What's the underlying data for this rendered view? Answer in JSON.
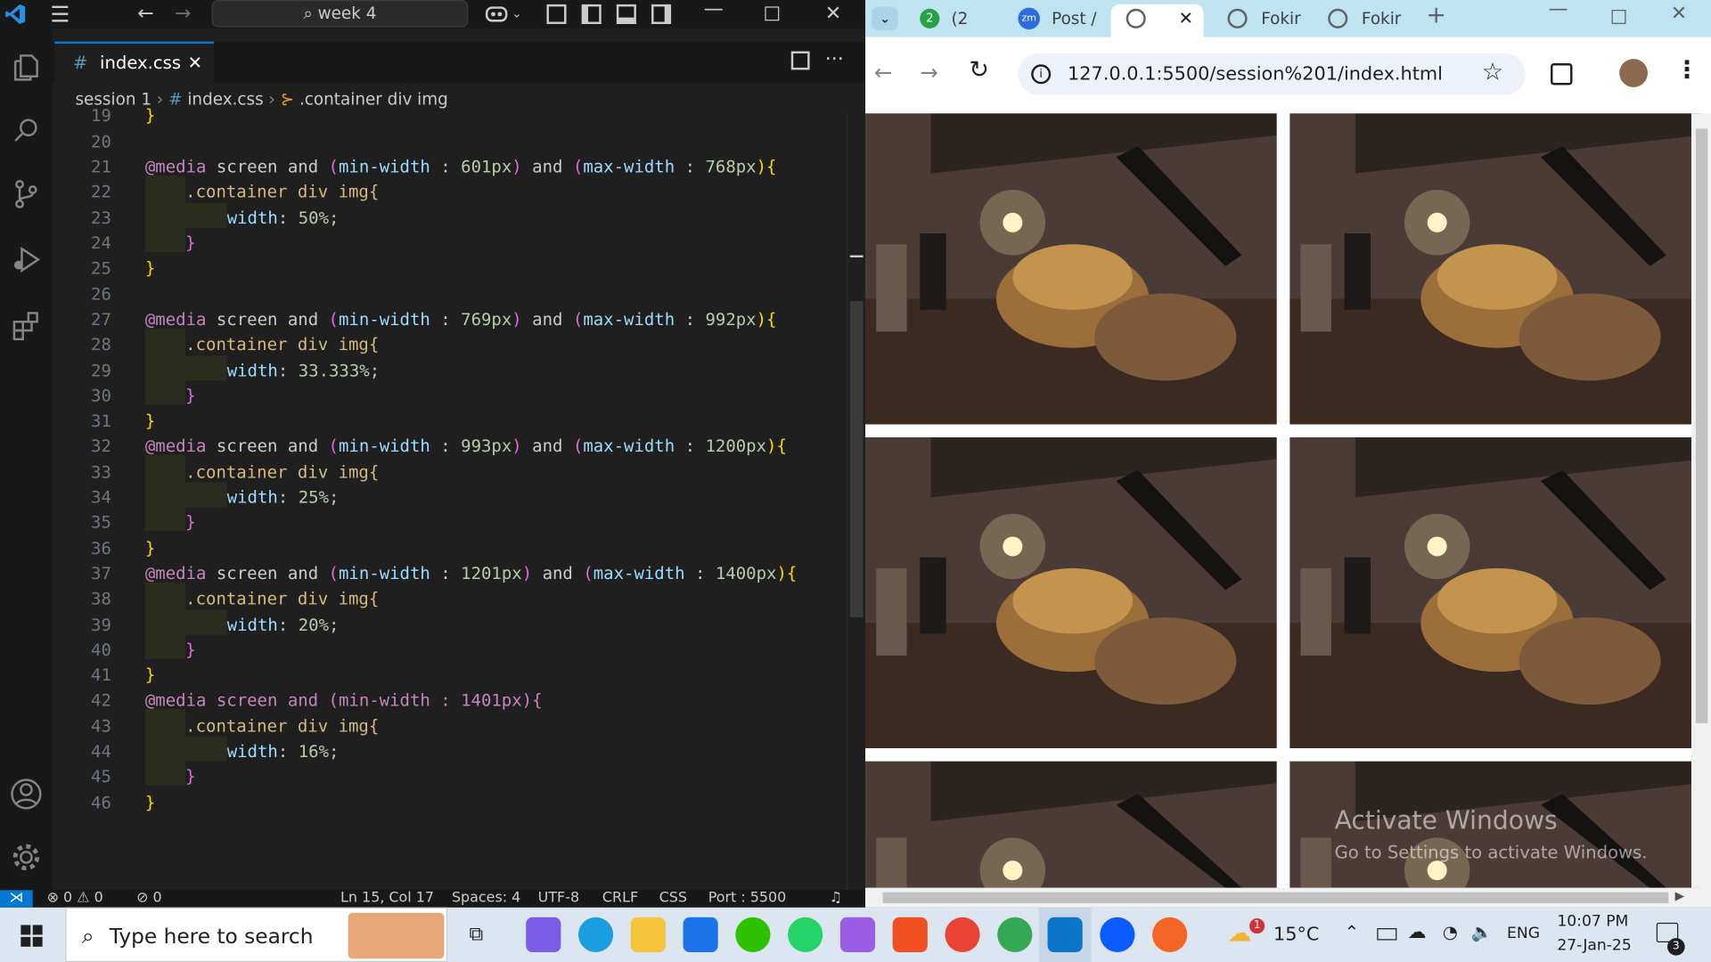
{
  "vscode": {
    "search_text": "week 4",
    "tab_title": "index.css",
    "breadcrumb": [
      "session 1",
      "index.css",
      ".container div img"
    ],
    "status_left": [
      "⊗ 0 ⚠ 0",
      "⊘ 0"
    ],
    "status_right": [
      "Ln 15, Col 17",
      "Spaces: 4",
      "UTF-8",
      "CRLF",
      "CSS",
      "Port : 5500"
    ],
    "line_numbers": [
      "19",
      "20",
      "21",
      "22",
      "23",
      "24",
      "25",
      "26",
      "27",
      "28",
      "29",
      "30",
      "31",
      "32",
      "33",
      "34",
      "35",
      "36",
      "37",
      "38",
      "39",
      "40",
      "41",
      "42",
      "43",
      "44",
      "45",
      "46"
    ]
  },
  "code_lines": [
    {
      "n": "21",
      "at": "@media",
      "kw": " screen ",
      "a": "and",
      "p1": " (",
      "f1": "min-width",
      "c1": " : ",
      "v1": "601px",
      "p2": ")",
      "a2": " and ",
      "p3": "(",
      "f2": "max-width",
      "c2": " : ",
      "v2": "768px",
      "end": "){"
    },
    {
      "n": "27",
      "at": "@media",
      "kw": " screen ",
      "a": "and",
      "p1": " (",
      "f1": "min-width",
      "c1": " : ",
      "v1": "769px",
      "p2": ")",
      "a2": " and ",
      "p3": "(",
      "f2": "max-width",
      "c2": " : ",
      "v2": "992px",
      "end": "){"
    },
    {
      "n": "32",
      "at": "@media",
      "kw": " screen ",
      "a": "and",
      "p1": " (",
      "f1": "min-width",
      "c1": " : ",
      "v1": "993px",
      "p2": ")",
      "a2": " and ",
      "p3": "(",
      "f2": "max-width",
      "c2": " : ",
      "v2": "1200px",
      "end": "){"
    },
    {
      "n": "37",
      "at": "@media",
      "kw": " screen ",
      "a": "and",
      "p1": " (",
      "f1": "min-width",
      "c1": " : ",
      "v1": "1201px",
      "p2": ")",
      "a2": " and ",
      "p3": "(",
      "f2": "max-width",
      "c2": " : ",
      "v2": "1400px",
      "end": "){"
    }
  ],
  "code": {
    "selector": ".container div img{",
    "prop": "width",
    "widths": [
      "50%;",
      "33.333%;",
      "25%;",
      "20%;",
      "16%;"
    ],
    "last_media": "@media screen and (min-width : 1401px){",
    "close_inner": "}",
    "close_outer": "}"
  },
  "browser": {
    "tabs": [
      "(2",
      "Post /",
      "",
      "Fokir",
      "Fokir"
    ],
    "tab_badge": "2",
    "url": "127.0.0.1:5500/session%201/index.html",
    "watermark_title": "Activate Windows",
    "watermark_sub": "Go to Settings to activate Windows."
  },
  "taskbar": {
    "search_placeholder": "Type here to search",
    "weather": "15°C",
    "lang": "ENG",
    "time": "10:07 PM",
    "date": "27-Jan-25",
    "notif_count": "3",
    "weather_badge": "1"
  }
}
